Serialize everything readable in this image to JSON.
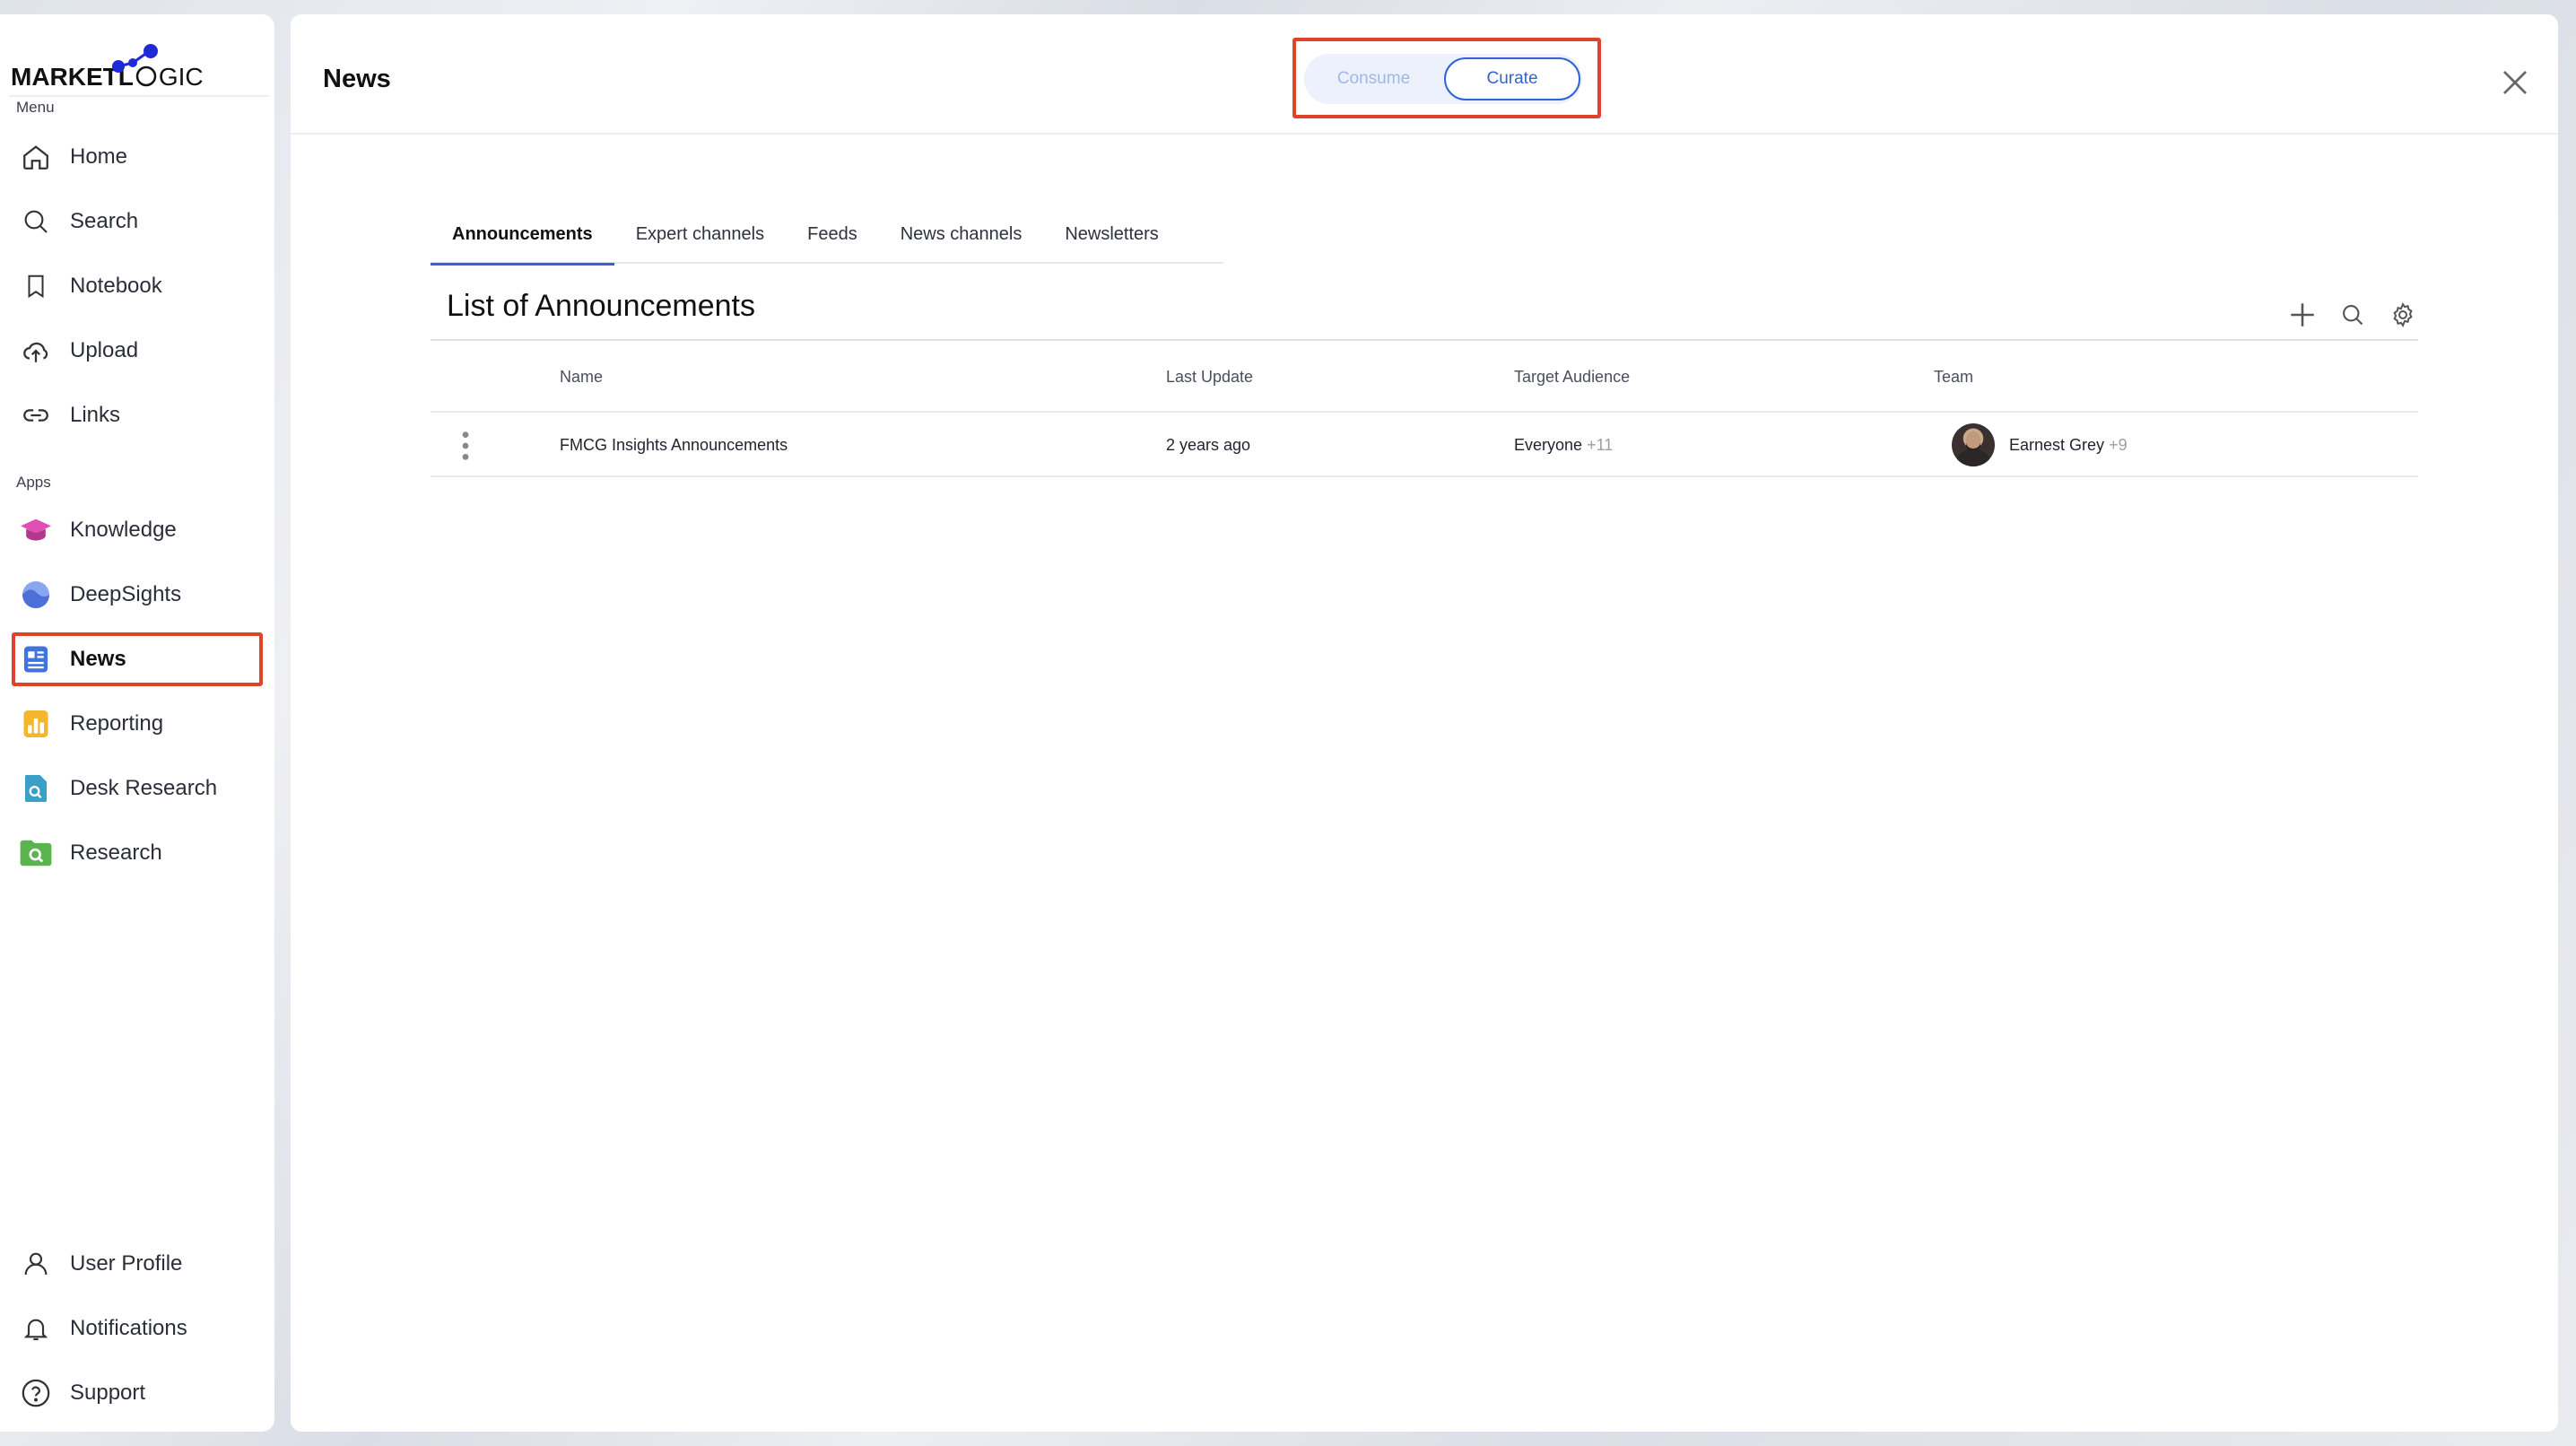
{
  "logo": {
    "bold": "MARKETL",
    "light": "GIC"
  },
  "sidebar": {
    "menu_label": "Menu",
    "menu_items": [
      {
        "label": "Home",
        "icon": "home-icon"
      },
      {
        "label": "Search",
        "icon": "search-icon"
      },
      {
        "label": "Notebook",
        "icon": "bookmark-icon"
      },
      {
        "label": "Upload",
        "icon": "upload-cloud-icon"
      },
      {
        "label": "Links",
        "icon": "link-icon"
      }
    ],
    "apps_label": "Apps",
    "app_items": [
      {
        "label": "Knowledge",
        "icon": "knowledge-cap-icon",
        "color": "#d94fb0"
      },
      {
        "label": "DeepSights",
        "icon": "deepsights-icon",
        "color": "#6f8fe8"
      },
      {
        "label": "News",
        "icon": "news-icon",
        "color": "#3f73e0",
        "active": true
      },
      {
        "label": "Reporting",
        "icon": "reporting-chart-icon",
        "color": "#f2b72f"
      },
      {
        "label": "Desk Research",
        "icon": "desk-research-icon",
        "color": "#3aa0c8"
      },
      {
        "label": "Research",
        "icon": "research-folder-icon",
        "color": "#5bb450"
      }
    ],
    "bottom_items": [
      {
        "label": "User Profile",
        "icon": "user-icon"
      },
      {
        "label": "Notifications",
        "icon": "bell-icon"
      },
      {
        "label": "Support",
        "icon": "help-circle-icon"
      }
    ]
  },
  "header": {
    "title": "News",
    "toggle": {
      "consume": "Consume",
      "curate": "Curate",
      "selected": "Curate"
    }
  },
  "tabs": [
    {
      "label": "Announcements",
      "active": true
    },
    {
      "label": "Expert channels"
    },
    {
      "label": "Feeds"
    },
    {
      "label": "News channels"
    },
    {
      "label": "Newsletters"
    }
  ],
  "list": {
    "title": "List of Announcements",
    "columns": [
      "Name",
      "Last Update",
      "Target Audience",
      "Team"
    ],
    "rows": [
      {
        "name": "FMCG Insights Announcements",
        "last_update": "2 years ago",
        "audience": "Everyone",
        "audience_extra": "+11",
        "team": "Earnest Grey",
        "team_extra": "+9"
      }
    ]
  },
  "colors": {
    "accent": "#2f63d6",
    "highlight": "#e0432a"
  }
}
